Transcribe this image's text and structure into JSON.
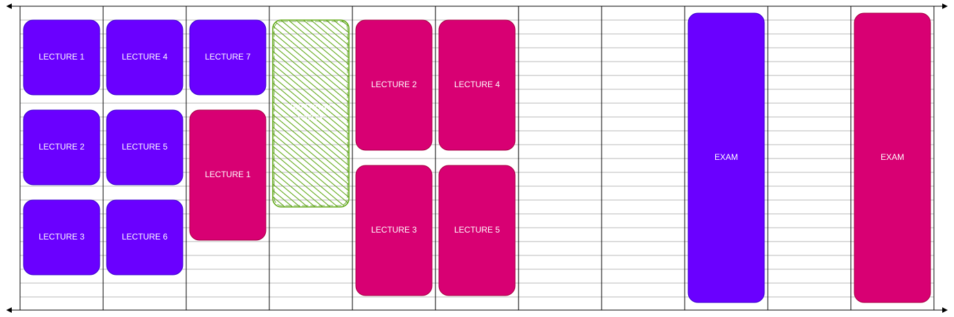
{
  "colors": {
    "purple": "#6a00ff",
    "magenta": "#d80073",
    "green": "#60a917",
    "grid": "#000000",
    "label": "#ffffff"
  },
  "blocks": [
    {
      "id": "w1-lecture-1",
      "label": "LECTURE 1",
      "color": "purple"
    },
    {
      "id": "w1-lecture-2",
      "label": "LECTURE 2",
      "color": "purple"
    },
    {
      "id": "w1-lecture-3",
      "label": "LECTURE 3",
      "color": "purple"
    },
    {
      "id": "w2-lecture-4",
      "label": "LECTURE 4",
      "color": "purple"
    },
    {
      "id": "w2-lecture-5",
      "label": "LECTURE 5",
      "color": "purple"
    },
    {
      "id": "w2-lecture-6",
      "label": "LECTURE 6",
      "color": "purple"
    },
    {
      "id": "w3-lecture-7",
      "label": "LECTURE 7",
      "color": "purple"
    },
    {
      "id": "w3-lecture-1",
      "label": "LECTURE 1",
      "color": "magenta"
    },
    {
      "id": "w4-birthday-party",
      "label": "BIRTHDAY PARTY",
      "color": "green",
      "hatched": true
    },
    {
      "id": "w5-lecture-2",
      "label": "LECTURE 2",
      "color": "magenta"
    },
    {
      "id": "w5-lecture-3",
      "label": "LECTURE 3",
      "color": "magenta"
    },
    {
      "id": "w6-lecture-4",
      "label": "LECTURE 4",
      "color": "magenta"
    },
    {
      "id": "w6-lecture-5",
      "label": "LECTURE 5",
      "color": "magenta"
    },
    {
      "id": "w9-exam",
      "label": "EXAM",
      "color": "purple"
    },
    {
      "id": "w11-exam",
      "label": "EXAM",
      "color": "magenta"
    }
  ]
}
